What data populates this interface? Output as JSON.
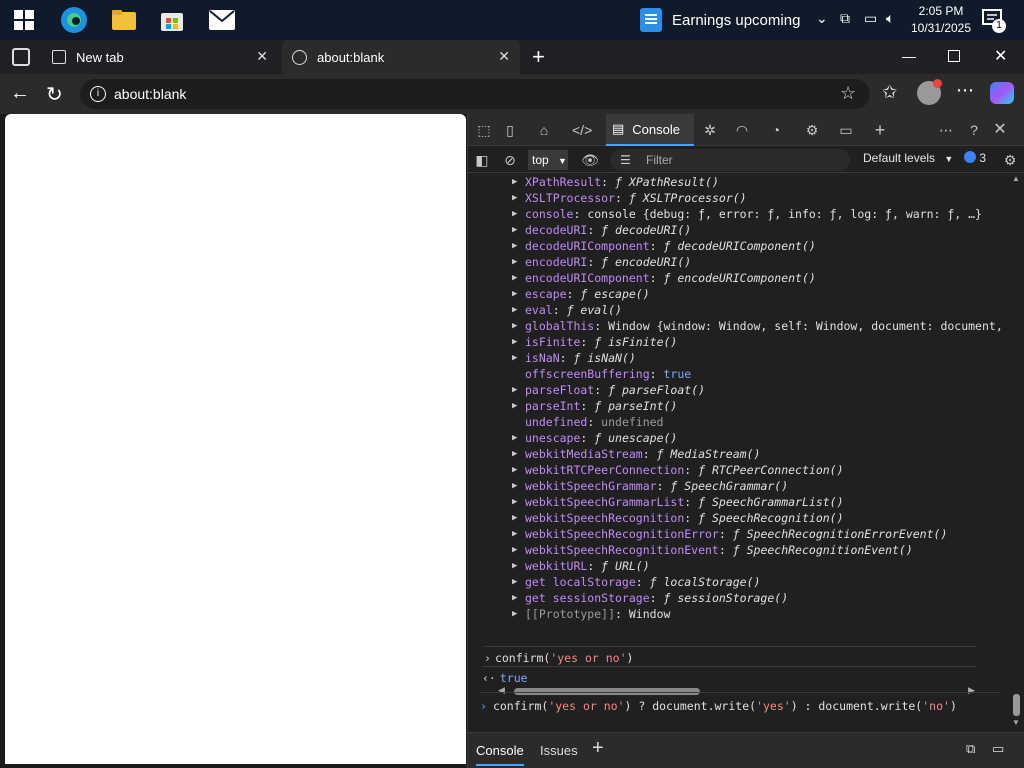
{
  "taskbar": {
    "news_text": "Earnings upcoming",
    "time": "2:05 PM",
    "date": "10/31/2025",
    "notification_count": "1"
  },
  "browser": {
    "tabs": [
      {
        "label": "New tab"
      },
      {
        "label": "about:blank"
      }
    ],
    "address": "about:blank"
  },
  "devtools": {
    "active_tab": "Console",
    "context": "top",
    "filter_placeholder": "Filter",
    "levels_label": "Default levels",
    "issues_count": "3",
    "log_lines": [
      {
        "key": "XPathResult",
        "sep": ": ",
        "fn": "ƒ ",
        "val": "XPathResult()",
        "expand": true
      },
      {
        "key": "XSLTProcessor",
        "sep": ": ",
        "fn": "ƒ ",
        "val": "XSLTProcessor()",
        "expand": true
      },
      {
        "key": "console",
        "sep": ": ",
        "fn": "",
        "val": "console {debug: ƒ, error: ƒ, info: ƒ, log: ƒ, warn: ƒ, …}",
        "expand": true
      },
      {
        "key": "decodeURI",
        "sep": ": ",
        "fn": "ƒ ",
        "val": "decodeURI()",
        "expand": true
      },
      {
        "key": "decodeURIComponent",
        "sep": ": ",
        "fn": "ƒ ",
        "val": "decodeURIComponent()",
        "expand": true
      },
      {
        "key": "encodeURI",
        "sep": ": ",
        "fn": "ƒ ",
        "val": "encodeURI()",
        "expand": true
      },
      {
        "key": "encodeURIComponent",
        "sep": ": ",
        "fn": "ƒ ",
        "val": "encodeURIComponent()",
        "expand": true
      },
      {
        "key": "escape",
        "sep": ": ",
        "fn": "ƒ ",
        "val": "escape()",
        "expand": true
      },
      {
        "key": "eval",
        "sep": ": ",
        "fn": "ƒ ",
        "val": "eval()",
        "expand": true
      },
      {
        "key": "globalThis",
        "sep": ": ",
        "fn": "",
        "val": "Window {window: Window, self: Window, document: document,",
        "expand": true
      },
      {
        "key": "isFinite",
        "sep": ": ",
        "fn": "ƒ ",
        "val": "isFinite()",
        "expand": true
      },
      {
        "key": "isNaN",
        "sep": ": ",
        "fn": "ƒ ",
        "val": "isNaN()",
        "expand": true
      },
      {
        "key": "offscreenBuffering",
        "sep": ": ",
        "fn": "",
        "val": "true",
        "expand": false,
        "valtype": "t"
      },
      {
        "key": "parseFloat",
        "sep": ": ",
        "fn": "ƒ ",
        "val": "parseFloat()",
        "expand": true
      },
      {
        "key": "parseInt",
        "sep": ": ",
        "fn": "ƒ ",
        "val": "parseInt()",
        "expand": true
      },
      {
        "key": "undefined",
        "sep": ": ",
        "fn": "",
        "val": "undefined",
        "expand": false,
        "valtype": "dim"
      },
      {
        "key": "unescape",
        "sep": ": ",
        "fn": "ƒ ",
        "val": "unescape()",
        "expand": true
      },
      {
        "key": "webkitMediaStream",
        "sep": ": ",
        "fn": "ƒ ",
        "val": "MediaStream()",
        "expand": true
      },
      {
        "key": "webkitRTCPeerConnection",
        "sep": ": ",
        "fn": "ƒ ",
        "val": "RTCPeerConnection()",
        "expand": true
      },
      {
        "key": "webkitSpeechGrammar",
        "sep": ": ",
        "fn": "ƒ ",
        "val": "SpeechGrammar()",
        "expand": true
      },
      {
        "key": "webkitSpeechGrammarList",
        "sep": ": ",
        "fn": "ƒ ",
        "val": "SpeechGrammarList()",
        "expand": true
      },
      {
        "key": "webkitSpeechRecognition",
        "sep": ": ",
        "fn": "ƒ ",
        "val": "SpeechRecognition()",
        "expand": true
      },
      {
        "key": "webkitSpeechRecognitionError",
        "sep": ": ",
        "fn": "ƒ ",
        "val": "SpeechRecognitionErrorEvent()",
        "expand": true
      },
      {
        "key": "webkitSpeechRecognitionEvent",
        "sep": ": ",
        "fn": "ƒ ",
        "val": "SpeechRecognitionEvent()",
        "expand": true
      },
      {
        "key": "webkitURL",
        "sep": ": ",
        "fn": "ƒ ",
        "val": "URL()",
        "expand": true
      },
      {
        "key": "get localStorage",
        "sep": ": ",
        "fn": "ƒ ",
        "val": "localStorage()",
        "expand": true
      },
      {
        "key": "get sessionStorage",
        "sep": ": ",
        "fn": "ƒ ",
        "val": "sessionStorage()",
        "expand": true
      },
      {
        "key": "[[Prototype]]",
        "sep": ": ",
        "fn": "",
        "val": "Window",
        "expand": true,
        "keytype": "dim"
      }
    ],
    "command_1": {
      "prefix": "confirm(",
      "arg": "'yes or no'",
      "suffix": ")"
    },
    "result_1": "true",
    "input": {
      "p1": "confirm(",
      "s1": "'yes or no'",
      "p2": ") ? document.write(",
      "s2": "'yes'",
      "p3": ") : document.write(",
      "s3": "'no'",
      "p4": ")"
    },
    "bottom_tabs": [
      "Console",
      "Issues"
    ]
  }
}
